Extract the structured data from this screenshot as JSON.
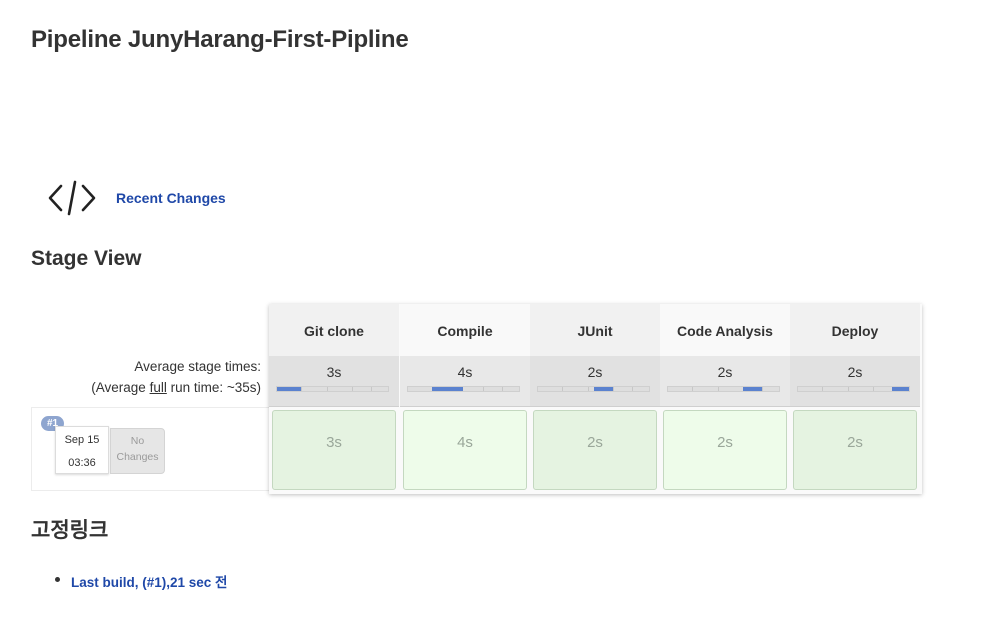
{
  "page": {
    "title": "Pipeline JunyHarang-First-Pipline"
  },
  "recent_changes": {
    "icon": "code-icon",
    "label": "Recent Changes"
  },
  "stage_view": {
    "heading": "Stage View",
    "avg_label": "Average stage times:",
    "avg_run_prefix": "(Average ",
    "avg_run_full": "full",
    "avg_run_suffix": " run time: ~35s)",
    "stages": [
      {
        "name": "Git clone",
        "avg": "3s",
        "bar_start": 0.0,
        "bar_fraction": 0.22,
        "time": "3s"
      },
      {
        "name": "Compile",
        "avg": "4s",
        "bar_start": 0.22,
        "bar_fraction": 0.28,
        "time": "4s"
      },
      {
        "name": "JUnit",
        "avg": "2s",
        "bar_start": 0.5,
        "bar_fraction": 0.18,
        "time": "2s"
      },
      {
        "name": "Code Analysis",
        "avg": "2s",
        "bar_start": 0.68,
        "bar_fraction": 0.17,
        "time": "2s"
      },
      {
        "name": "Deploy",
        "avg": "2s",
        "bar_start": 0.85,
        "bar_fraction": 0.15,
        "time": "2s"
      }
    ],
    "build": {
      "number": "#1",
      "date": "Sep 15",
      "time": "03:36",
      "changes": "No Changes"
    },
    "colors": {
      "success_cell": "#e5f3e1",
      "success_cell_alt": "#eefcea",
      "bar_fill": "#5b82cf"
    }
  },
  "permalinks": {
    "heading": "고정링크",
    "items": [
      "Last build, (#1),21 sec 전"
    ]
  }
}
